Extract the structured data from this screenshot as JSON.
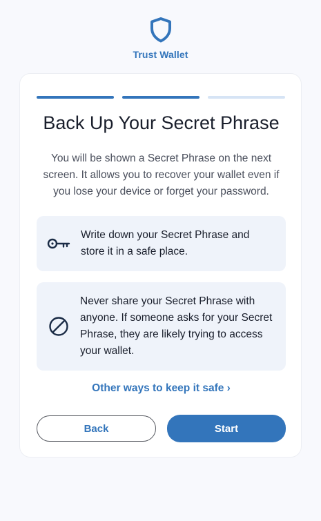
{
  "brand": {
    "name": "Trust Wallet",
    "accent_color": "#3375bb",
    "logo_icon": "shield-icon"
  },
  "progress": {
    "total_steps": 3,
    "current_step": 2,
    "active_color": "#3375bb",
    "inactive_color": "#d6e4f5"
  },
  "main": {
    "title": "Back Up Your Secret Phrase",
    "description": "You will be shown a Secret Phrase on the next screen. It allows you to recover your wallet even if you lose your device or forget your password."
  },
  "tips": [
    {
      "icon": "key-icon",
      "text": "Write down your Secret Phrase and store it in a safe place."
    },
    {
      "icon": "prohibited-icon",
      "text": "Never share your Secret Phrase with anyone. If someone asks for your Secret Phrase, they are likely trying to access your wallet."
    }
  ],
  "links": {
    "other_ways": "Other ways to keep it safe ›"
  },
  "buttons": {
    "back_label": "Back",
    "start_label": "Start"
  }
}
